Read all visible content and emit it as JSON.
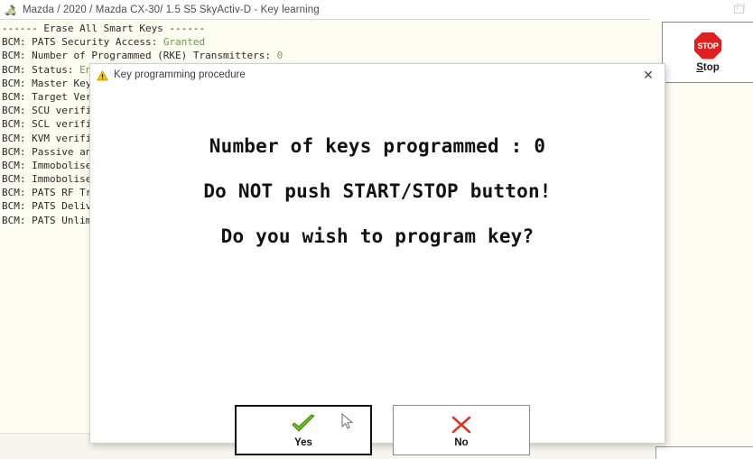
{
  "window": {
    "title": "Mazda / 2020 / Mazda CX-30/ 1.5 S5 SkyActiv-D - Key learning",
    "app_icon": "car-diagnostic-icon",
    "restore_button": "restore-window-icon"
  },
  "log": {
    "lines": [
      {
        "text": "------ Erase All Smart Keys ------",
        "value": "",
        "value_type": ""
      },
      {
        "text": "BCM: PATS Security Access: ",
        "value": "Granted",
        "value_type": "ok"
      },
      {
        "text": "BCM: Number of Programmed (RKE) Transmitters: ",
        "value": "0",
        "value_type": "num"
      },
      {
        "text": "BCM: Status: ",
        "value": "Enabled",
        "value_type": "ok"
      },
      {
        "text": "BCM: Master Key",
        "value": "",
        "value_type": ""
      },
      {
        "text": "BCM: Target Veri",
        "value": "",
        "value_type": ""
      },
      {
        "text": "BCM: SCU verifie",
        "value": "",
        "value_type": ""
      },
      {
        "text": "BCM: SCL verifie",
        "value": "",
        "value_type": ""
      },
      {
        "text": "BCM: KVM verifie",
        "value": "",
        "value_type": ""
      },
      {
        "text": "BCM: Passive ant",
        "value": "",
        "value_type": ""
      },
      {
        "text": "BCM: Immobolise",
        "value": "",
        "value_type": ""
      },
      {
        "text": "BCM: Immobolise",
        "value": "",
        "value_type": ""
      },
      {
        "text": "BCM: PATS RF Tr",
        "value": "",
        "value_type": ""
      },
      {
        "text": "BCM: PATS Delive",
        "value": "",
        "value_type": ""
      },
      {
        "text": "BCM: PATS Unlimi",
        "value": "",
        "value_type": ""
      }
    ]
  },
  "stop_panel": {
    "icon": "stop-sign-icon",
    "icon_text": "STOP",
    "label_accel": "S",
    "label_rest": "top"
  },
  "dialog": {
    "title": "Key programming procedure",
    "title_icon": "warning-triangle-icon",
    "close_label": "✕",
    "messages": [
      "Number of keys programmed : 0",
      "Do NOT push START/STOP button!",
      "Do you wish to program key?"
    ],
    "keys_programmed": "0",
    "buttons": [
      {
        "label": "Yes",
        "icon": "green-check-icon",
        "focused": true
      },
      {
        "label": "No",
        "icon": "red-cross-icon",
        "focused": false
      }
    ]
  },
  "colors": {
    "app_background": "#fdfdf4",
    "log_value_ok": "#6b9b4c",
    "log_value_num": "#8a9a52",
    "stop_red": "#e02020",
    "check_green": "#63c020",
    "cross_red": "#d03a2a"
  }
}
